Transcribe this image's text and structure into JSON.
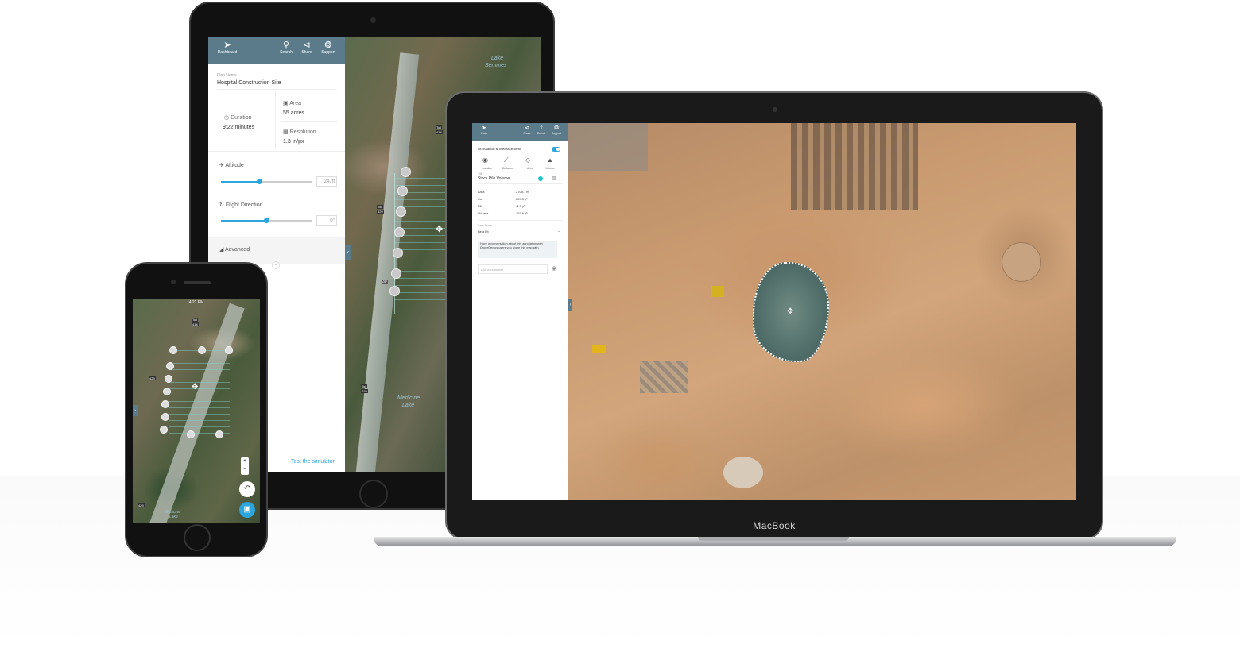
{
  "tablet": {
    "header": {
      "dashboard": "Dashboard",
      "search": "Search",
      "share": "Share",
      "support": "Support"
    },
    "plan_name_label": "Plan Name",
    "plan_name": "Hospital Construction Site",
    "duration_label": "Duration",
    "duration": "9:22 minutes",
    "area_label": "Area",
    "area": "55 acres",
    "resolution_label": "Resolution",
    "resolution": "1.3 in/px",
    "altitude_label": "Altitude",
    "altitude_value": "247ft",
    "altitude_level": 0.42,
    "flight_direction_label": "Flight Direction",
    "flight_direction_value": "0°",
    "flight_direction_level": 0.5,
    "advanced_label": "Advanced",
    "simulator_link": "Test the simulator",
    "map_labels": {
      "lake1": "Lake",
      "lake2": "Semmes",
      "lake3": "Medicine",
      "lake4": "Lake",
      "toll1": "Toll",
      "road1": "414",
      "toll2": "Toll",
      "road2": "429",
      "road3": "30",
      "toll3": "Toll",
      "road4": "429"
    }
  },
  "laptop": {
    "brand": "MacBook",
    "header": {
      "back": "Data",
      "share": "Share",
      "export": "Export",
      "support": "Support"
    },
    "section_title": "Annotation & Measurement",
    "tools": [
      "Location",
      "Distance",
      "Area",
      "Volume"
    ],
    "title_label": "Title",
    "title_value": "Stock Pile Volume",
    "rows": [
      {
        "label": "Area",
        "value": "2708.1 ft²"
      },
      {
        "label": "Cut",
        "value": "259.3 y³"
      },
      {
        "label": "Fill",
        "value": "-1.7 y³"
      },
      {
        "label": "Volume",
        "value": "257.5 y³"
      }
    ],
    "base_plane_label": "Base Plane",
    "base_plane_value": "Best Fit",
    "note": "Have a conversation about this annotation with DroneDeploy users you share this map with.",
    "comment_placeholder": "Add a comment"
  },
  "phone": {
    "time": "4:21 PM",
    "map_labels": {
      "toll": "Toll",
      "road1": "414",
      "road2": "429",
      "road3": "429",
      "lake1": "Medicine",
      "lake2": "Lake"
    },
    "zoom_in": "+",
    "zoom_out": "−"
  },
  "colors": {
    "header": "#5b7b8b",
    "accent": "#2ca6dd"
  }
}
